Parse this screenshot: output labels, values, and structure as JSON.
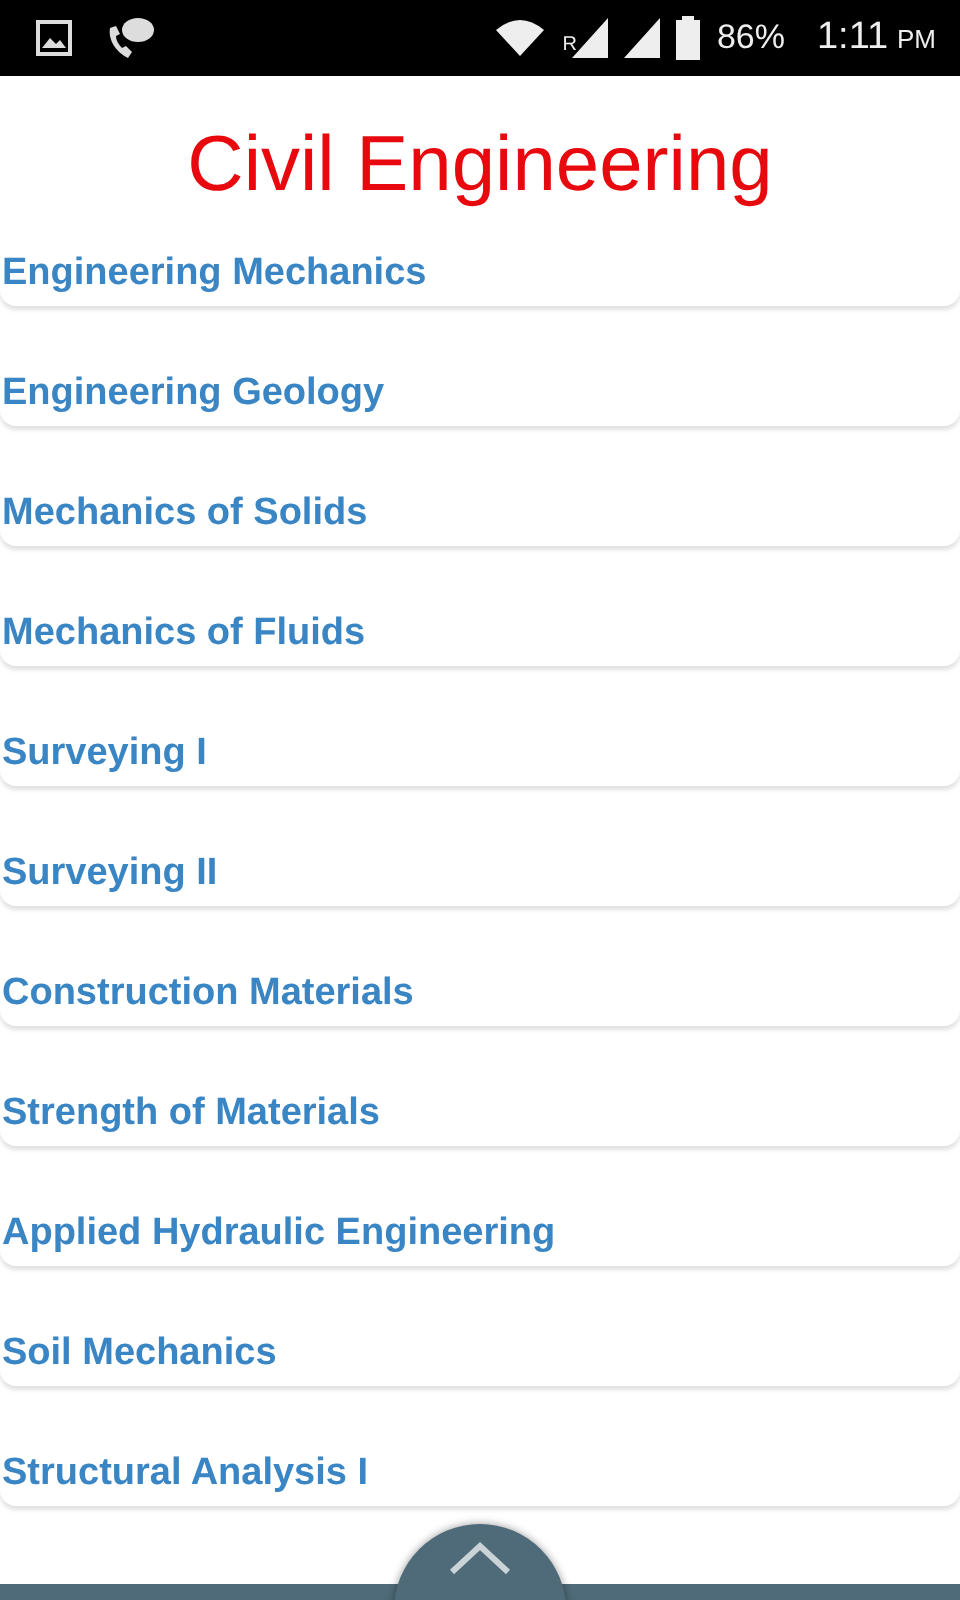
{
  "status_bar": {
    "roaming": "R",
    "battery": "86%",
    "time": "1:11",
    "period": "PM"
  },
  "title": "Civil Engineering",
  "subjects": [
    {
      "label": "Engineering Mechanics"
    },
    {
      "label": "Engineering Geology"
    },
    {
      "label": "Mechanics of Solids"
    },
    {
      "label": "Mechanics of Fluids"
    },
    {
      "label": "Surveying I"
    },
    {
      "label": "Surveying II"
    },
    {
      "label": "Construction Materials"
    },
    {
      "label": "Strength of Materials"
    },
    {
      "label": "Applied Hydraulic Engineering"
    },
    {
      "label": "Soil Mechanics"
    },
    {
      "label": "Structural Analysis I"
    }
  ]
}
